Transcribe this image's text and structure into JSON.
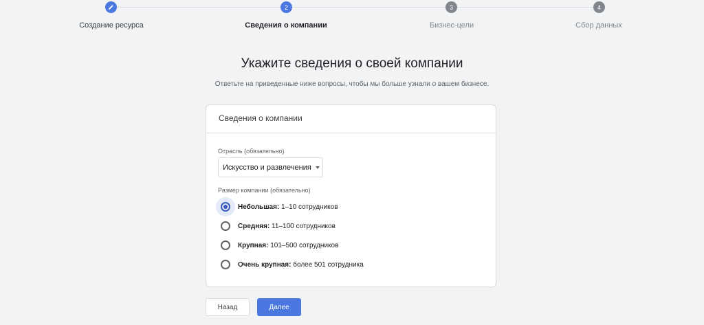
{
  "stepper": {
    "steps": [
      {
        "number": "",
        "label": "Создание ресурса",
        "state": "done",
        "icon": "pencil-icon"
      },
      {
        "number": "2",
        "label": "Сведения о компании",
        "state": "current"
      },
      {
        "number": "3",
        "label": "Бизнес-цели",
        "state": "todo"
      },
      {
        "number": "4",
        "label": "Сбор данных",
        "state": "todo"
      }
    ]
  },
  "page": {
    "title": "Укажите сведения о своей компании",
    "subtitle": "Ответьте на приведенные ниже вопросы, чтобы мы больше узнали о вашем бизнесе."
  },
  "card": {
    "header": "Сведения о компании",
    "industry": {
      "label": "Отрасль (обязательно)",
      "value": "Искусство и развлечения"
    },
    "size": {
      "label": "Размер компании (обязательно)",
      "options": [
        {
          "name": "Небольшая:",
          "detail": " 1–10 сотрудников",
          "checked": true
        },
        {
          "name": "Средняя:",
          "detail": " 11–100 сотрудников",
          "checked": false
        },
        {
          "name": "Крупная:",
          "detail": " 101–500 сотрудников",
          "checked": false
        },
        {
          "name": "Очень крупная:",
          "detail": " более 501 сотрудника",
          "checked": false
        }
      ]
    }
  },
  "buttons": {
    "back": "Назад",
    "next": "Далее"
  },
  "colors": {
    "accent": "#4a78e0",
    "radio_checked": "#3c5bb8",
    "background": "#f1f3f4"
  }
}
